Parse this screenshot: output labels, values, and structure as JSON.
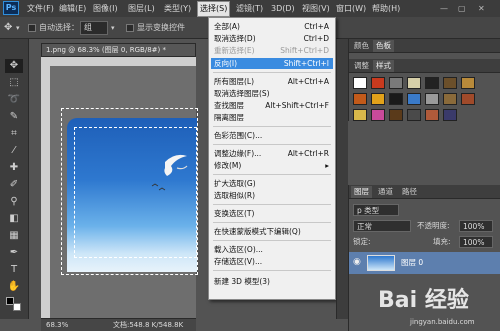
{
  "menubar": {
    "logo": "Ps",
    "items": [
      "文件(F)",
      "编辑(E)",
      "图像(I)",
      "图层(L)",
      "类型(Y)",
      "选择(S)",
      "滤镜(T)",
      "3D(D)",
      "视图(V)",
      "窗口(W)",
      "帮助(H)"
    ]
  },
  "options": {
    "auto_select_label": "自动选择：",
    "auto_select_value": "组",
    "show_transform_label": "显示变换控件"
  },
  "document": {
    "tab_title": "1.png @ 68.3% (图层 0, RGB/8#) *",
    "zoom": "68.3%",
    "doc_info": "文档:548.8 K/548.8K"
  },
  "select_menu": {
    "items": [
      {
        "label": "全部(A)",
        "shortcut": "Ctrl+A",
        "state": "normal"
      },
      {
        "label": "取消选择(D)",
        "shortcut": "Ctrl+D",
        "state": "normal"
      },
      {
        "label": "重新选择(E)",
        "shortcut": "Shift+Ctrl+D",
        "state": "disabled"
      },
      {
        "label": "反向(I)",
        "shortcut": "Shift+Ctrl+I",
        "state": "highlighted"
      },
      {
        "label": "所有图层(L)",
        "shortcut": "Alt+Ctrl+A",
        "state": "normal"
      },
      {
        "label": "取消选择图层(S)",
        "shortcut": "",
        "state": "normal"
      },
      {
        "label": "查找图层",
        "shortcut": "Alt+Shift+Ctrl+F",
        "state": "normal"
      },
      {
        "label": "隔离图层",
        "shortcut": "",
        "state": "normal"
      },
      {
        "label": "色彩范围(C)...",
        "shortcut": "",
        "state": "normal"
      },
      {
        "label": "调整边缘(F)...",
        "shortcut": "Alt+Ctrl+R",
        "state": "normal"
      },
      {
        "label": "修改(M)",
        "shortcut": "▸",
        "state": "normal"
      },
      {
        "label": "扩大选取(G)",
        "shortcut": "",
        "state": "normal"
      },
      {
        "label": "选取相似(R)",
        "shortcut": "",
        "state": "normal"
      },
      {
        "label": "变换选区(T)",
        "shortcut": "",
        "state": "normal"
      },
      {
        "label": "在快速蒙版模式下编辑(Q)",
        "shortcut": "",
        "state": "normal"
      },
      {
        "label": "载入选区(O)...",
        "shortcut": "",
        "state": "normal"
      },
      {
        "label": "存储选区(V)...",
        "shortcut": "",
        "state": "normal"
      },
      {
        "label": "新建 3D 模型(3)",
        "shortcut": "",
        "state": "normal"
      }
    ]
  },
  "swatch_panel": {
    "tabs": [
      "颜色",
      "色板"
    ],
    "style_tabs": [
      "调整",
      "样式"
    ]
  },
  "layers_panel": {
    "tabs": [
      "图层",
      "通道",
      "路径"
    ],
    "kind_label": "p 类型",
    "blend_mode": "正常",
    "opacity_label": "不透明度:",
    "opacity_value": "100%",
    "lock_label": "锁定:",
    "fill_label": "填充:",
    "fill_value": "100%",
    "layer_name": "图层 0"
  },
  "watermark": {
    "text": "Bai 经验",
    "sub": "jingyan.baidu.com"
  },
  "colors": {
    "menu_highlight": "#3a8be0",
    "layer_selected": "#5d7fae"
  }
}
